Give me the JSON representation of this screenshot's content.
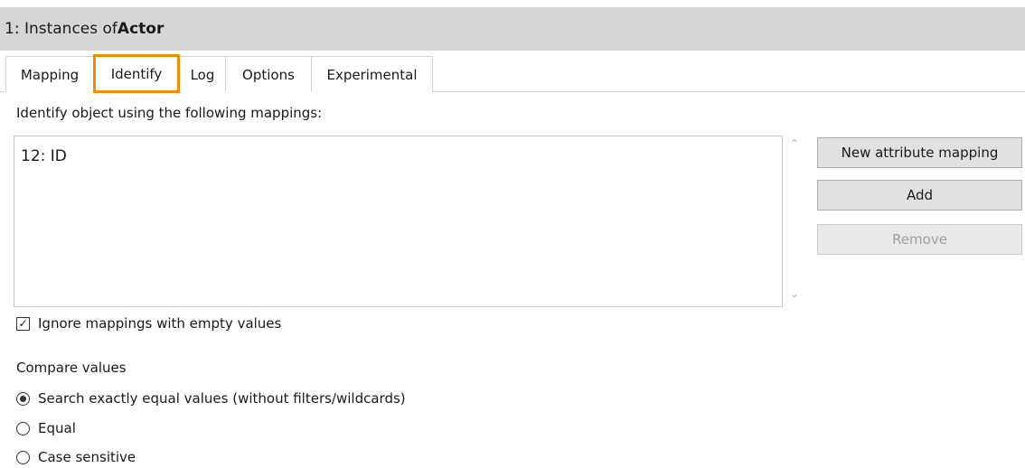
{
  "header": {
    "prefix": "1: Instances of ",
    "object": "Actor"
  },
  "tabs": [
    {
      "label": "Mapping",
      "active": false
    },
    {
      "label": "Identify",
      "active": true
    },
    {
      "label": "Log",
      "active": false
    },
    {
      "label": "Options",
      "active": false
    },
    {
      "label": "Experimental",
      "active": false
    }
  ],
  "identify": {
    "section_label": "Identify object using the following mappings:",
    "mappings": [
      "12: ID"
    ],
    "buttons": {
      "new_attribute_mapping": "New attribute mapping",
      "add": "Add",
      "remove": "Remove"
    },
    "ignore_empty": {
      "label": "Ignore mappings with empty values",
      "checked": true
    },
    "compare": {
      "label": "Compare values",
      "options": [
        {
          "label": "Search exactly equal values (without filters/wildcards)",
          "selected": true
        },
        {
          "label": "Equal",
          "selected": false
        },
        {
          "label": "Case sensitive",
          "selected": false
        }
      ]
    }
  },
  "colors": {
    "tab_highlight": "#f28c00",
    "header_bg": "#d6d6d6"
  }
}
